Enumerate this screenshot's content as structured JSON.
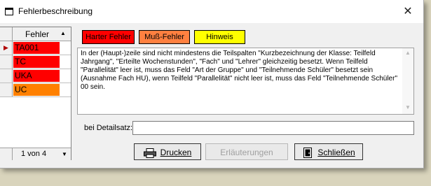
{
  "window": {
    "title": "Fehlerbeschreibung",
    "close_glyph": "✕"
  },
  "grid": {
    "header": "Fehler",
    "rows": [
      {
        "value": "TA001",
        "color": "#ff0000",
        "current": true,
        "marker": "▶"
      },
      {
        "value": "TC",
        "color": "#ff0000",
        "current": false,
        "marker": ""
      },
      {
        "value": "UKA",
        "color": "#ff0000",
        "current": false,
        "marker": ""
      },
      {
        "value": "UC",
        "color": "#ff8000",
        "current": false,
        "marker": ""
      }
    ],
    "page": "1 von 4"
  },
  "legend": [
    {
      "label": "Harter Fehler",
      "color": "#ff0000"
    },
    {
      "label": "Muß-Fehler",
      "color": "#ff8040"
    },
    {
      "label": "Hinweis",
      "color": "#ffff00"
    }
  ],
  "description": "In der (Haupt-)zeile sind nicht mindestens die Teilspalten \"Kurzbezeichnung der Klasse: Teilfeld Jahrgang\", \"Erteilte Wochenstunden\", \"Fach\" und \"Lehrer\" gleichzeitig besetzt. Wenn Teilfeld \"Parallelität\" leer ist, muss das Feld \"Art der Gruppe\" und \"Teilnehmende Schüler\" besetzt sein (Ausnahme Fach HU), wenn Teilfeld \"Parallelität\" nicht leer ist, muss das Feld \"Teilnehmende Schüler\" 00 sein.",
  "detail": {
    "label": "bei Detailsatz:",
    "value": ""
  },
  "buttons": {
    "print": "Drucken",
    "explain": "Erläuterungen",
    "close": "Schließen"
  },
  "icons": {
    "window": "window-icon",
    "printer": "printer-icon",
    "door": "exit-icon"
  }
}
